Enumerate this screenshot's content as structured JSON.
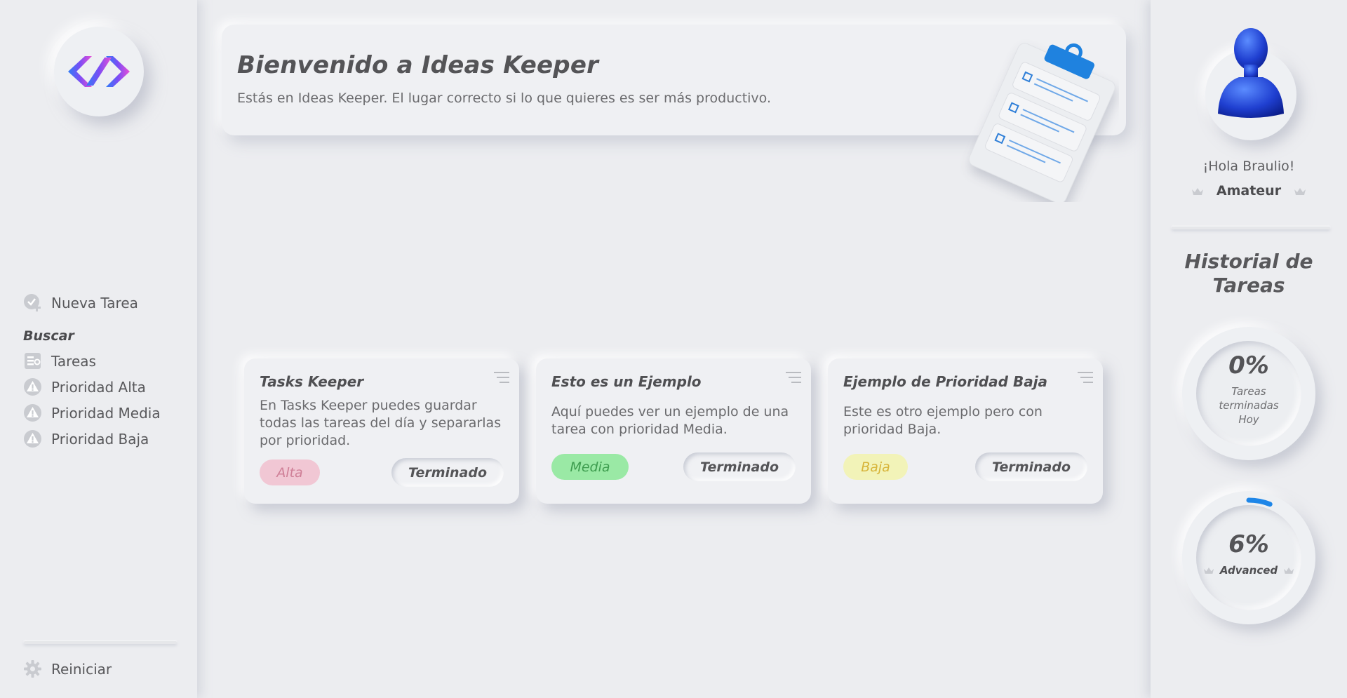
{
  "app": {
    "name": "Ideas Keeper",
    "accent_gradient": [
      "#2f7df6",
      "#7b4df5",
      "#e94fd6"
    ]
  },
  "sidebar": {
    "logo_icon": "code-logo-icon",
    "new_task": {
      "label": "Nueva Tarea",
      "icon": "add-task-icon"
    },
    "search_heading": "Buscar",
    "search_items": [
      {
        "label": "Tareas",
        "icon": "list-icon"
      },
      {
        "label": "Prioridad Alta",
        "icon": "warning-icon"
      },
      {
        "label": "Prioridad Media",
        "icon": "warning-icon"
      },
      {
        "label": "Prioridad Baja",
        "icon": "warning-icon"
      }
    ],
    "reset": {
      "label": "Reiniciar",
      "icon": "gear-icon"
    }
  },
  "banner": {
    "title": "Bienvenido a Ideas Keeper",
    "subtitle": "Estás en Ideas Keeper. El lugar correcto si lo que quieres es ser más productivo.",
    "illustration": "clipboard-icon"
  },
  "tasks": [
    {
      "title": "Tasks Keeper",
      "description": "En Tasks Keeper puedes guardar todas las tareas del día y separarlas por prioridad.",
      "priority": "Alta",
      "priority_color": "#f1c7d4",
      "done_label": "Terminado"
    },
    {
      "title": "Esto es un Ejemplo",
      "description": "Aquí puedes ver un ejemplo de una tarea con prioridad Media.",
      "priority": "Media",
      "priority_color": "#9ae9a5",
      "done_label": "Terminado"
    },
    {
      "title": "Ejemplo de Prioridad Baja",
      "description": "Este es otro ejemplo pero con prioridad Baja.",
      "priority": "Baja",
      "priority_color": "#f2f3b8",
      "done_label": "Terminado"
    }
  ],
  "profile": {
    "greeting": "¡Hola Braulio!",
    "rank": "Amateur",
    "avatar_icon": "user-avatar-icon"
  },
  "history": {
    "title": "Historial de Tareas",
    "today": {
      "value": "0%",
      "progress": 0,
      "label": "Tareas terminadas Hoy"
    },
    "level": {
      "value": "6%",
      "progress": 0.06,
      "label": "Advanced",
      "color": "#1e86e8"
    }
  }
}
